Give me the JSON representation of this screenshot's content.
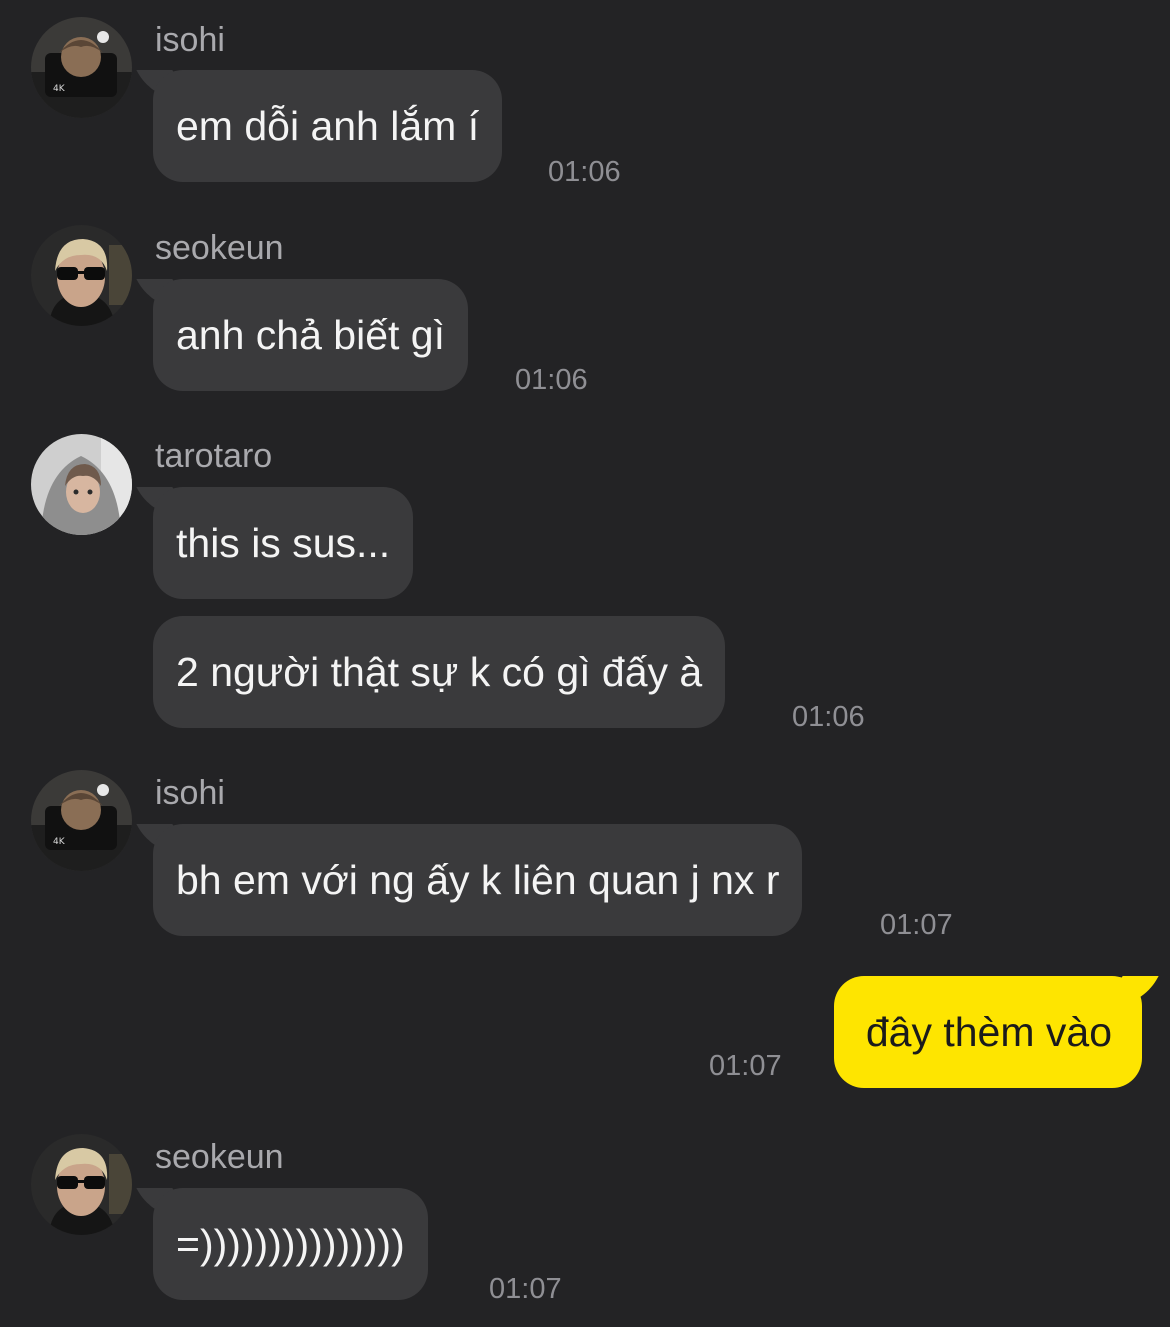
{
  "colors": {
    "background": "#232325",
    "incoming_bubble": "#3a3a3c",
    "outgoing_bubble": "#fee500",
    "sender_name": "#a9a9ad",
    "timestamp": "#8f8f94"
  },
  "messages": [
    {
      "sender": "isohi",
      "text": "em dỗi anh lắm í",
      "time": "01:06",
      "avatar": "isohi-avatar"
    },
    {
      "sender": "seokeun",
      "text": "anh chả biết gì",
      "time": "01:06",
      "avatar": "seokeun-avatar"
    },
    {
      "sender": "tarotaro",
      "text": "this is sus...",
      "avatar": "tarotaro-avatar"
    },
    {
      "text": "2 người thật sự k có gì đấy à",
      "time": "01:06"
    },
    {
      "sender": "isohi",
      "text": "bh em với ng ấy k liên quan j nx r",
      "time": "01:07",
      "avatar": "isohi-avatar"
    },
    {
      "text": "đây thèm vào",
      "time": "01:07",
      "outgoing": true
    },
    {
      "sender": "seokeun",
      "text": "=)))))))))))))))",
      "time": "01:07",
      "avatar": "seokeun-avatar"
    }
  ]
}
